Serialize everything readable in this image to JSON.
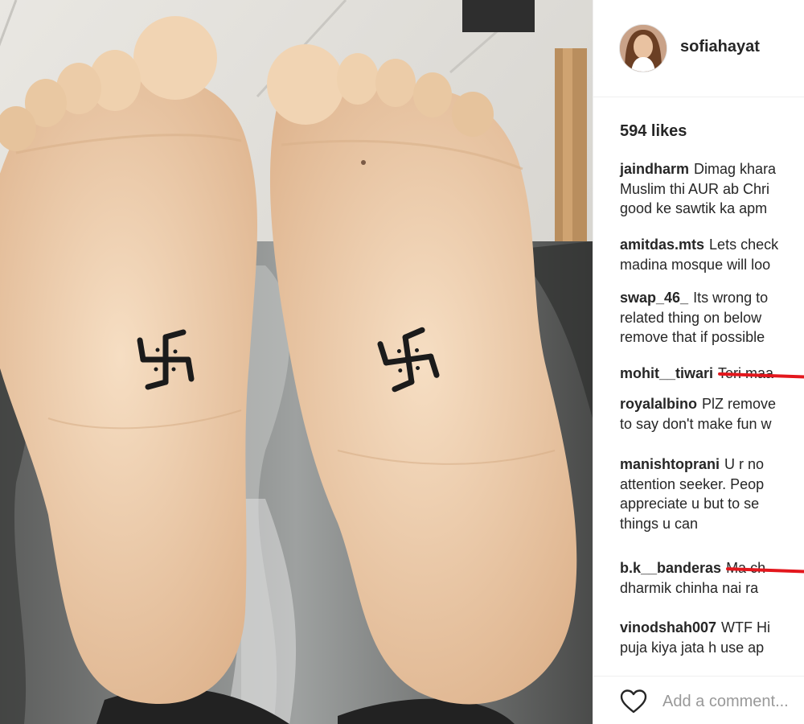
{
  "post": {
    "username": "sofiahayat",
    "likes": "594 likes",
    "add_comment_placeholder": "Add a comment...",
    "avatar_icon": "profile-avatar",
    "like_icon": "heart-outline-icon"
  },
  "comments": [
    {
      "user": "jaindharm",
      "lines": [
        "Dimag khara",
        "Muslim thi AUR ab Chri",
        "good ke sawtik ka apm"
      ]
    },
    {
      "user": "amitdas.mts",
      "lines": [
        "Lets check",
        "madina mosque will loo"
      ]
    },
    {
      "user": "swap_46_",
      "lines": [
        "Its wrong to",
        "related thing on below",
        "remove that if possible"
      ]
    },
    {
      "user": "mohit__tiwari",
      "lines": [
        "Teri maa"
      ]
    },
    {
      "user": "royalalbino",
      "lines": [
        "PlZ remove",
        "to say don't make fun w"
      ]
    },
    {
      "user": "manishtoprani",
      "lines": [
        "U r no",
        "attention seeker. Peop",
        "appreciate u but to se",
        "things u can"
      ]
    },
    {
      "user": "b.k__banderas",
      "lines": [
        "Ma ch",
        "dharmik chinha nai ra"
      ]
    },
    {
      "user": "vinodshah007",
      "lines": [
        "WTF Hi",
        "puja kiya jata h use ap"
      ]
    }
  ],
  "colors": {
    "redaction": "#e3171d",
    "text": "#262626",
    "muted": "#999999"
  }
}
